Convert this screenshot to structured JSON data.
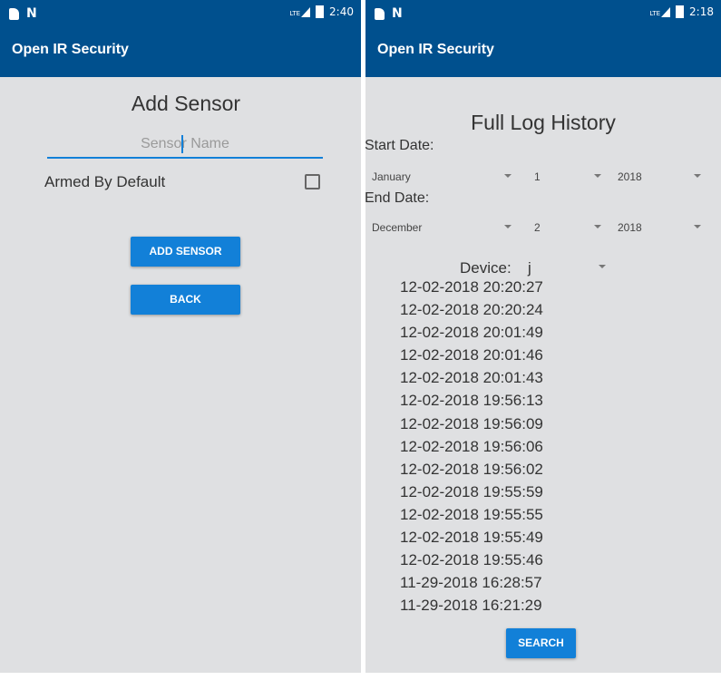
{
  "left": {
    "status": {
      "time": "2:40",
      "network": "LTE"
    },
    "app_title": "Open IR Security",
    "page_title": "Add Sensor",
    "sensor_name_placeholder": "Sensor Name",
    "armed_label": "Armed By Default",
    "armed_checked": false,
    "add_button": "ADD SENSOR",
    "back_button": "BACK"
  },
  "right": {
    "status": {
      "time": "2:18",
      "network": "LTE"
    },
    "app_title": "Open IR Security",
    "page_title": "Full Log History",
    "start_label": "Start Date:",
    "start": {
      "month": "January",
      "day": "1",
      "year": "2018"
    },
    "end_label": "End Date:",
    "end": {
      "month": "December",
      "day": "2",
      "year": "2018"
    },
    "device_label": "Device:",
    "device_value": "j",
    "logs": [
      "12-02-2018 20:20:27",
      "12-02-2018 20:20:24",
      "12-02-2018 20:01:49",
      "12-02-2018 20:01:46",
      "12-02-2018 20:01:43",
      "12-02-2018 19:56:13",
      "12-02-2018 19:56:09",
      "12-02-2018 19:56:06",
      "12-02-2018 19:56:02",
      "12-02-2018 19:55:59",
      "12-02-2018 19:55:55",
      "12-02-2018 19:55:49",
      "12-02-2018 19:55:46",
      "11-29-2018 16:28:57",
      "11-29-2018 16:21:29"
    ],
    "search_button": "SEARCH"
  },
  "colors": {
    "appbar": "#00508e",
    "accent": "#1280d8",
    "background": "#dfe0e2"
  }
}
